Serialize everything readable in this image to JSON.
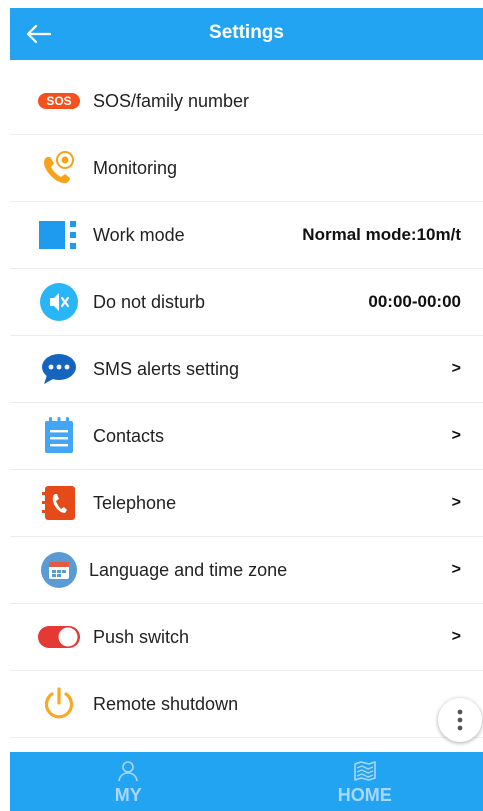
{
  "header": {
    "title": "Settings",
    "back_icon": "arrow-left-icon"
  },
  "settings": [
    {
      "label": "SOS/family number",
      "value": "",
      "chevron": false,
      "icon": "sos-icon",
      "badge": "SOS",
      "color": "#f4511e"
    },
    {
      "label": "Monitoring",
      "value": "",
      "chevron": false,
      "icon": "phone-monitor-icon",
      "color": "#f7a21b"
    },
    {
      "label": "Work mode",
      "value": "Normal mode:10m/t",
      "chevron": false,
      "icon": "work-mode-icon",
      "color": "#1e9bef"
    },
    {
      "label": "Do not disturb",
      "value": "00:00-00:00",
      "chevron": false,
      "icon": "mute-icon",
      "color": "#29b6f6"
    },
    {
      "label": "SMS alerts setting",
      "value": "",
      "chevron": true,
      "chevron_text": ">",
      "icon": "chat-bubble-icon",
      "color": "#1565c0"
    },
    {
      "label": "Contacts",
      "value": "",
      "chevron": true,
      "chevron_text": ">",
      "icon": "notepad-icon",
      "color": "#42a5f5"
    },
    {
      "label": "Telephone",
      "value": "",
      "chevron": true,
      "chevron_text": ">",
      "icon": "phone-book-icon",
      "color": "#e64a19"
    },
    {
      "label": "Language and time zone",
      "value": "",
      "chevron": true,
      "chevron_text": ">",
      "icon": "calendar-icon",
      "color": "#5b9bd5"
    },
    {
      "label": "Push switch",
      "value": "",
      "chevron": true,
      "chevron_text": ">",
      "icon": "toggle-icon",
      "color": "#e53935"
    },
    {
      "label": "Remote shutdown",
      "value": "",
      "chevron": false,
      "icon": "power-icon",
      "color": "#f9a825"
    }
  ],
  "bottom_nav": [
    {
      "label": "MY",
      "icon": "person-icon"
    },
    {
      "label": "HOME",
      "icon": "home-map-icon"
    }
  ],
  "fab": {
    "icon": "more-vertical-icon"
  },
  "colors": {
    "accent": "#22a4f2",
    "tab_text": "#a9d8fb"
  }
}
